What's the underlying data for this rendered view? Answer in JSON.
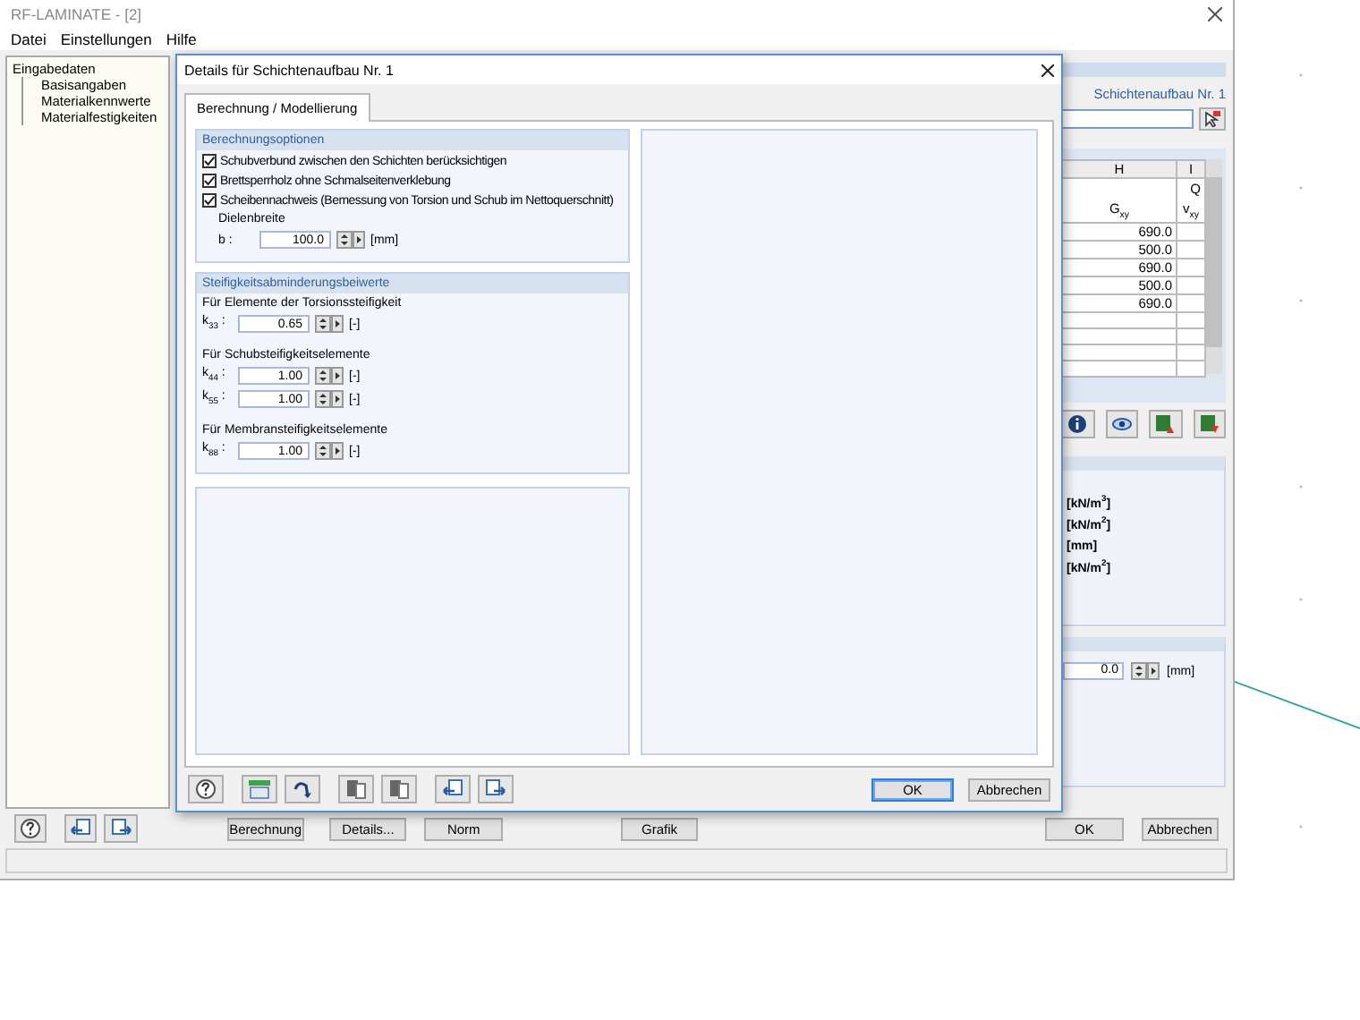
{
  "main_window": {
    "title": "RF-LAMINATE - [2]",
    "menu": [
      "Datei",
      "Einstellungen",
      "Hilfe"
    ],
    "tree": {
      "label": "Eingabedaten",
      "children": [
        {
          "label": "Basisangaben"
        },
        {
          "label": "Materialkennwerte"
        },
        {
          "label": "Materialfestigkeiten"
        }
      ]
    },
    "header": "Schichtenaufbau Nr. 1",
    "table": {
      "columns": [
        {
          "letter": "H",
          "title": "G$_{xy}$"
        },
        {
          "letter": "I",
          "group": "Q",
          "title": "v$_{xy}$"
        }
      ],
      "rows": [
        [
          "690.0"
        ],
        [
          "500.0"
        ],
        [
          "690.0"
        ],
        [
          "500.0"
        ],
        [
          "690.0"
        ]
      ]
    },
    "units": [
      "[kN/m$^{3}$]",
      "[kN/m$^{2}$]",
      "[mm]",
      "[kN/m$^{2}$]"
    ],
    "offset": {
      "value": "0.0",
      "unit": "[mm]"
    },
    "buttons": [
      "Berechnung",
      "Details...",
      "Norm",
      "Grafik",
      "OK",
      "Abbrechen"
    ]
  },
  "dialog": {
    "title": "Details für Schichtenaufbau Nr. 1",
    "tabs": [
      {
        "label": "Berechnung / Modellierung",
        "selected": true
      }
    ],
    "options_group": {
      "title": "Berechnungsoptionen",
      "options": [
        {
          "label": "Schubverbund zwischen den Schichten berücksichtigen",
          "checked": true
        },
        {
          "label": "Brettsperrholz ohne Schmalseitenverklebung",
          "checked": true
        },
        {
          "label": "Scheibennachweis (Bemessung von Torsion und Schub im Nettoquerschnitt)",
          "checked": true
        }
      ]
    },
    "board_width": {
      "label": "Dielenbreite",
      "symbol": "b :",
      "value": "100.0",
      "unit": "[mm]"
    },
    "stiffness_group": {
      "title": "Steifigkeitsabminderungsbeiwerte",
      "sections": [
        {
          "title": "Für Elemente der Torsionssteifigkeit",
          "fields": [
            {
              "symbol": "k$_{33}$ :",
              "value": "0.65",
              "unit": "[-]"
            }
          ]
        },
        {
          "title": "Für Schubsteifigkeitselemente",
          "fields": [
            {
              "symbol": "k$_{44}$ :",
              "value": "1.00",
              "unit": "[-]"
            },
            {
              "symbol": "k$_{55}$ :",
              "value": "1.00",
              "unit": "[-]"
            }
          ]
        },
        {
          "title": "Für Membransteifigkeitselemente",
          "fields": [
            {
              "symbol": "k$_{88}$ :",
              "value": "1.00",
              "unit": "[-]"
            }
          ]
        }
      ]
    },
    "buttons": [
      {
        "label": "OK",
        "default": true
      },
      {
        "label": "Abbrechen",
        "default": false
      }
    ]
  }
}
